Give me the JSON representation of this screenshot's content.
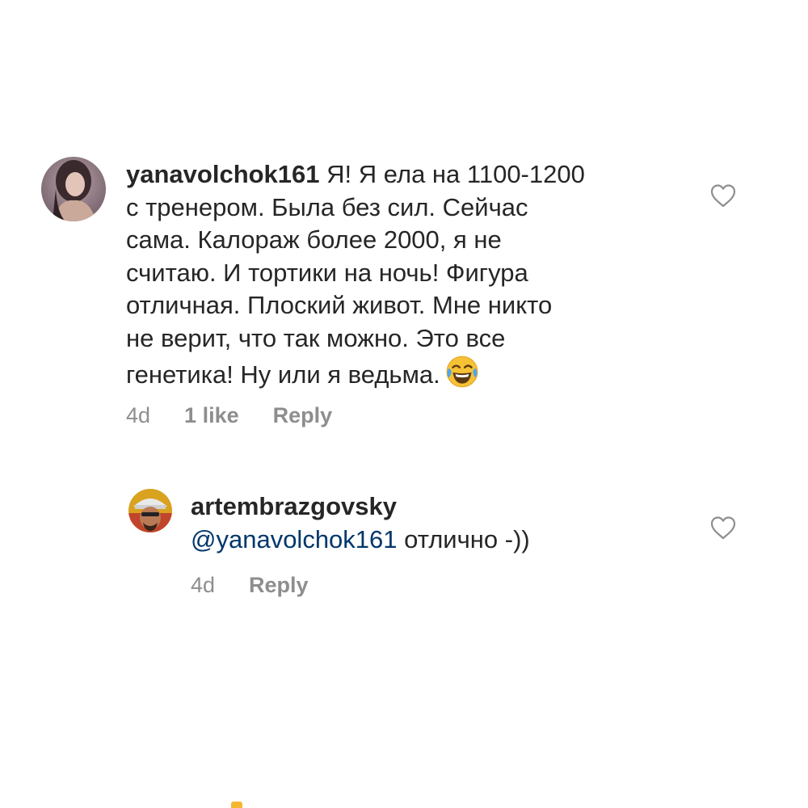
{
  "comments": [
    {
      "username": "yanavolchok161",
      "text_lines": [
        "Я! Я ела на 1100-1200",
        "с тренером.  Была без сил. Сейчас",
        "сама. Калораж более 2000, я не",
        "считаю. И тортики на ночь! Фигура",
        "отличная. Плоский живот. Мне никто",
        "не верит, что так можно. Это все",
        "генетика! Ну или я ведьма."
      ],
      "emoji": "face-with-tears-of-joy",
      "time": "4d",
      "likes": "1 like",
      "reply_label": "Reply"
    },
    {
      "username": "artembrazgovsky",
      "mention": "@yanavolchok161",
      "text": " отлично -))",
      "time": "4d",
      "reply_label": "Reply"
    }
  ],
  "colors": {
    "text": "#262626",
    "meta": "#8e8e8e",
    "mention": "#00376b",
    "heart_outline": "#8e8e8e"
  }
}
